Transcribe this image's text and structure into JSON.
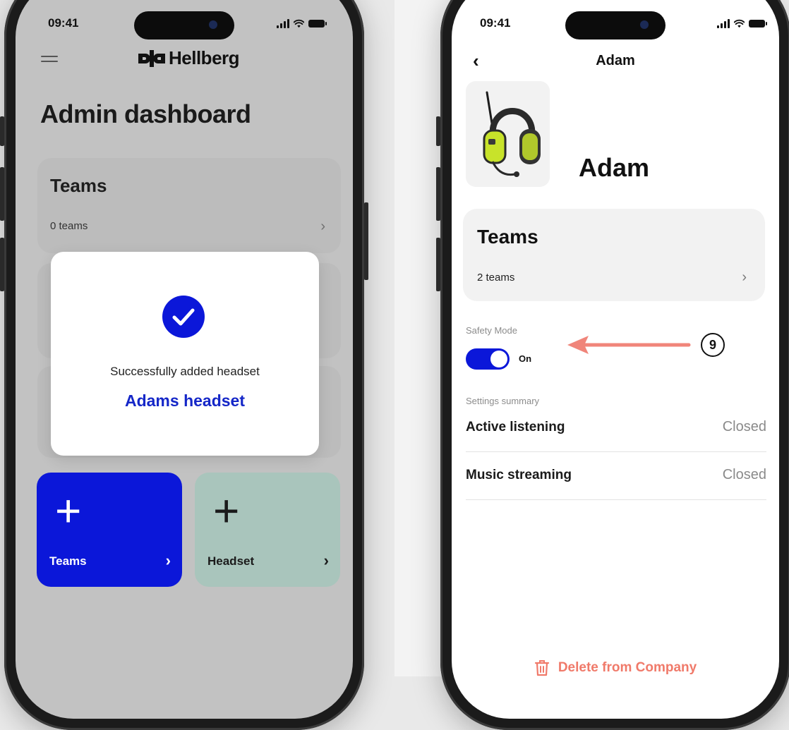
{
  "status_bar": {
    "time": "09:41"
  },
  "left_screen": {
    "brand": "Hellberg",
    "title": "Admin dashboard",
    "teams_card": {
      "title": "Teams",
      "subtitle": "0 teams"
    },
    "modal": {
      "message": "Successfully added headset",
      "name": "Adams headset"
    },
    "tiles": [
      {
        "label": "Teams",
        "color": "#0b17d9"
      },
      {
        "label": "Headset",
        "color": "#a9c5bc"
      }
    ]
  },
  "right_screen": {
    "nav_title": "Adam",
    "profile_name": "Adam",
    "teams_card": {
      "title": "Teams",
      "subtitle": "2 teams"
    },
    "safety_mode": {
      "label": "Safety Mode",
      "state_label": "On",
      "enabled": true
    },
    "settings_summary": {
      "label": "Settings summary",
      "rows": [
        {
          "label": "Active listening",
          "value": "Closed"
        },
        {
          "label": "Music streaming",
          "value": "Closed"
        }
      ]
    },
    "delete_label": "Delete from Company"
  },
  "annotation": {
    "number": "9",
    "color": "#f0857a"
  }
}
